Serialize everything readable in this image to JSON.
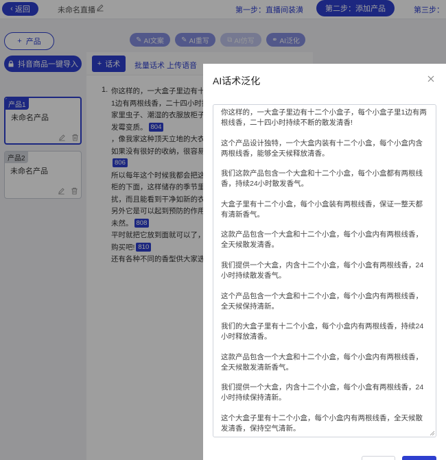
{
  "topbar": {
    "back_label": "返回",
    "live_title": "未命名直播",
    "steps": [
      "第一步：直播间装潢",
      "第二步：添加产品",
      "第三步："
    ]
  },
  "sidebar": {
    "add_product_label": "产品",
    "import_label": "抖音商品一键导入",
    "products": [
      {
        "tag": "产品1",
        "name": "未命名产品"
      },
      {
        "tag": "产品2",
        "name": "未命名产品"
      }
    ]
  },
  "ai_toolbar": {
    "buttons": [
      "AI文案",
      "AI重写",
      "AI仿写",
      "AI泛化"
    ]
  },
  "script_panel": {
    "add_script_label": "话术",
    "batch_label": "批量话术",
    "upload_label": "上传语音",
    "item_number": "1.",
    "lines": [
      {
        "text": "你这样的，一大盒子里边有十二",
        "badge": ""
      },
      {
        "text": "1边有两根线香，二十四小时持",
        "badge": ""
      },
      {
        "text": "家里虫子、潮湿的衣服放柜子的",
        "badge": ""
      },
      {
        "text": "发霉变质。",
        "badge": "804"
      },
      {
        "text": "，像我家这种顶天立地的大衣",
        "badge": ""
      },
      {
        "text": "如果没有很好的收纳，很容易发",
        "badge": ""
      },
      {
        "text": "",
        "badge": "806"
      },
      {
        "text": "所以每年这个时候我都会把这款",
        "badge": ""
      },
      {
        "text": "柜的下面，这样储存的季节里不",
        "badge": ""
      },
      {
        "text": "扰，而且能看到干净如新的衣物",
        "badge": ""
      },
      {
        "text": "另外它是可以起到预防的作用，",
        "badge": ""
      },
      {
        "text": "未然。",
        "badge": "808"
      },
      {
        "text": "平时就把它放到面就可以了，可",
        "badge": ""
      },
      {
        "text": "购买吧!",
        "badge": "810"
      },
      {
        "text": "还有各种不同的香型供大家选择",
        "badge": ""
      }
    ]
  },
  "modal": {
    "title": "AI话术泛化",
    "paragraphs": [
      "你这样的，一大盒子里边有十二个小盒子，每个小盒子里1边有两根线香，二十四小时持续不断的散发清香!",
      "这个产品设计独特，一个大盒内装有十二个小盒，每个小盒内含两根线香，能够全天候释放清香。",
      "我们这款产品包含一个大盒和十二个小盒，每个小盒都有两根线香，持续24小时散发香气。",
      "大盒子里有十二个小盒，每个小盒装有两根线香，保证一整天都有清新香气。",
      "这款产品包含一个大盒和十二个小盒，每个小盒内有两根线香，全天候散发清香。",
      "我们提供一个大盒，内含十二个小盒，每个小盒有两根线香，24小时持续散发香气。",
      "这个产品包含一个大盒和十二个小盒，每个小盒内有两根线香，全天候保持清新。",
      "我们的大盒子里有十二个小盒，每个小盒内有两根线香，持续24小时释放清香。",
      "这款产品包含一个大盒和十二个小盒，每个小盒内有两根线香，全天候散发清新香气。",
      "我们提供一个大盒，内含十二个小盒，每个小盒有两根线香，24小时持续保持清新。",
      "这个大盒子里有十二个小盒，每个小盒内有两根线香，全天候散发清香，保持空气清新。"
    ]
  },
  "colors": {
    "accent": "#2e3fcf",
    "overlay": "#000000"
  }
}
